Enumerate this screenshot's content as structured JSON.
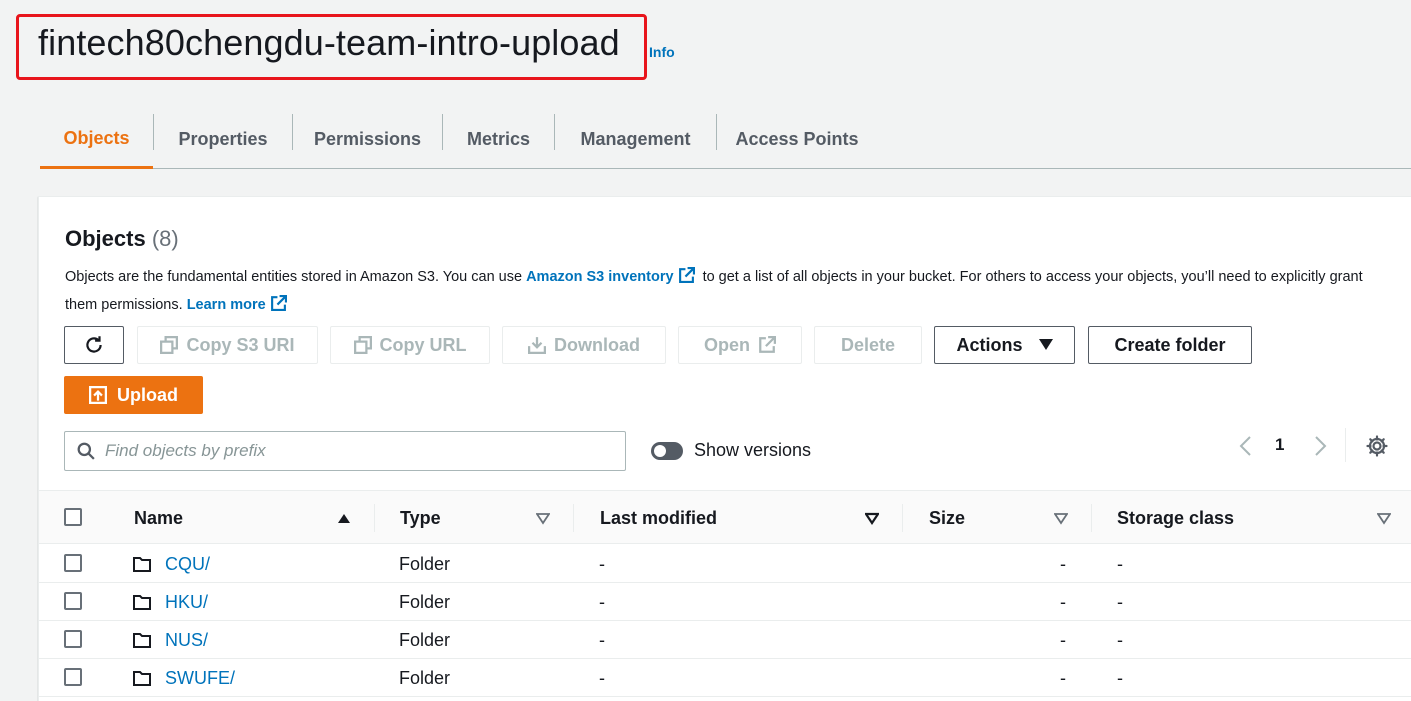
{
  "header": {
    "bucket_name": "fintech80chengdu-team-intro-upload",
    "info_label": "Info"
  },
  "tabs": [
    {
      "label": "Objects",
      "active": true
    },
    {
      "label": "Properties",
      "active": false
    },
    {
      "label": "Permissions",
      "active": false
    },
    {
      "label": "Metrics",
      "active": false
    },
    {
      "label": "Management",
      "active": false
    },
    {
      "label": "Access Points",
      "active": false
    }
  ],
  "objects_panel": {
    "title": "Objects",
    "count": "(8)",
    "description_part1": "Objects are the fundamental entities stored in Amazon S3. You can use",
    "inventory_link": "Amazon S3 inventory",
    "description_part2": "to get a list of all objects in your bucket. For others to access your objects, you’ll need to explicitly grant them permissions.",
    "learn_more": "Learn more"
  },
  "toolbar": {
    "copy_s3_uri": "Copy S3 URI",
    "copy_url": "Copy URL",
    "download": "Download",
    "open": "Open",
    "delete": "Delete",
    "actions": "Actions",
    "create_folder": "Create folder",
    "upload": "Upload"
  },
  "search": {
    "placeholder": "Find objects by prefix",
    "value": ""
  },
  "versions_toggle": {
    "label": "Show versions",
    "on": false
  },
  "pagination": {
    "current_page": "1"
  },
  "table": {
    "columns": [
      "Name",
      "Type",
      "Last modified",
      "Size",
      "Storage class"
    ],
    "rows": [
      {
        "name": "CQU/",
        "type": "Folder",
        "last_modified": "-",
        "size": "-",
        "storage_class": "-"
      },
      {
        "name": "HKU/",
        "type": "Folder",
        "last_modified": "-",
        "size": "-",
        "storage_class": "-"
      },
      {
        "name": "NUS/",
        "type": "Folder",
        "last_modified": "-",
        "size": "-",
        "storage_class": "-"
      },
      {
        "name": "SWUFE/",
        "type": "Folder",
        "last_modified": "-",
        "size": "-",
        "storage_class": "-"
      }
    ]
  },
  "colors": {
    "accent": "#ec7211",
    "link": "#0073bb",
    "highlight_box": "#e8141b",
    "text": "#16191f",
    "disabled": "#aab7b8"
  }
}
